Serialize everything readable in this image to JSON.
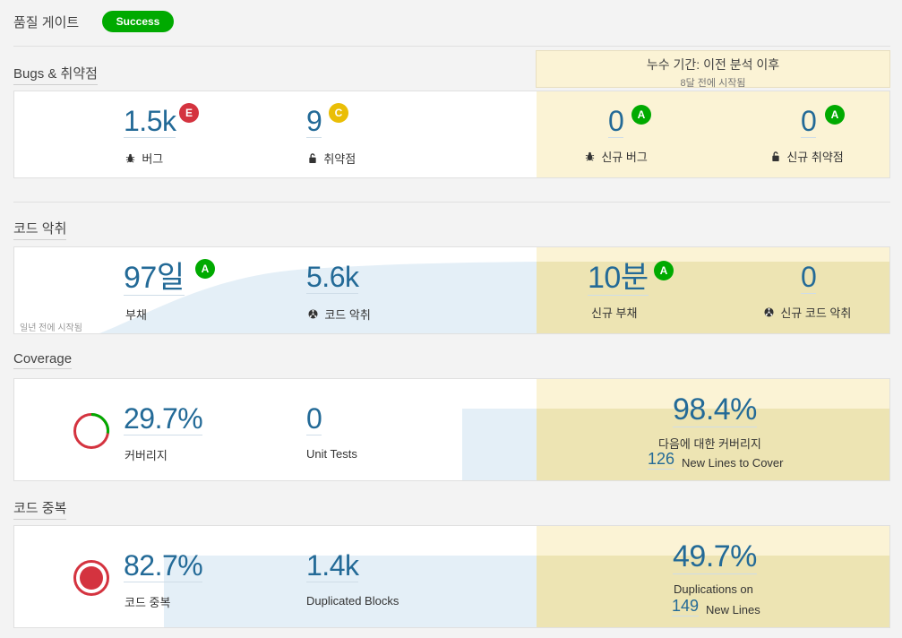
{
  "quality_gate": {
    "title": "품질 게이트",
    "status": "Success"
  },
  "leak_period": {
    "title": "누수 기간: 이전 분석 이후",
    "subtitle": "8달 전에 시작됨"
  },
  "bugs_section": {
    "title": "Bugs & 취약점",
    "bugs": {
      "value": "1.5k",
      "rating": "E",
      "label": "버그"
    },
    "vulnerabilities": {
      "value": "9",
      "rating": "C",
      "label": "취약점"
    },
    "new_bugs": {
      "value": "0",
      "rating": "A",
      "label": "신규 버그"
    },
    "new_vulnerabilities": {
      "value": "0",
      "rating": "A",
      "label": "신규 취약점"
    }
  },
  "smells_section": {
    "title": "코드 악취",
    "started_note": "일년 전에 시작됨",
    "debt": {
      "value": "97일",
      "rating": "A",
      "label": "부채"
    },
    "code_smells": {
      "value": "5.6k",
      "label": "코드 악취"
    },
    "new_debt": {
      "value": "10분",
      "rating": "A",
      "label": "신규 부채"
    },
    "new_code_smells": {
      "value": "0",
      "label": "신규 코드 악취"
    }
  },
  "coverage_section": {
    "title": "Coverage",
    "coverage": {
      "value": "29.7%",
      "label": "커버리지",
      "fraction": 0.297
    },
    "unit_tests": {
      "value": "0",
      "label": "Unit Tests"
    },
    "new_coverage": {
      "value": "98.4%",
      "label": "다음에 대한 커버리지",
      "lines_value": "126",
      "lines_label": "New Lines to Cover"
    }
  },
  "duplications_section": {
    "title": "코드 중복",
    "duplications": {
      "value": "82.7%",
      "label": "코드 중복"
    },
    "duplicated_blocks": {
      "value": "1.4k",
      "label": "Duplicated Blocks"
    },
    "new_duplications": {
      "value": "49.7%",
      "label": "Duplications on",
      "lines_value": "149",
      "lines_label": "New Lines"
    }
  },
  "colors": {
    "success": "#00aa00",
    "rating_a": "#00aa00",
    "rating_c": "#eabe06",
    "rating_e": "#d4333f",
    "measure_blue": "#236a97",
    "leak_yellow": "#fbf3d5"
  }
}
